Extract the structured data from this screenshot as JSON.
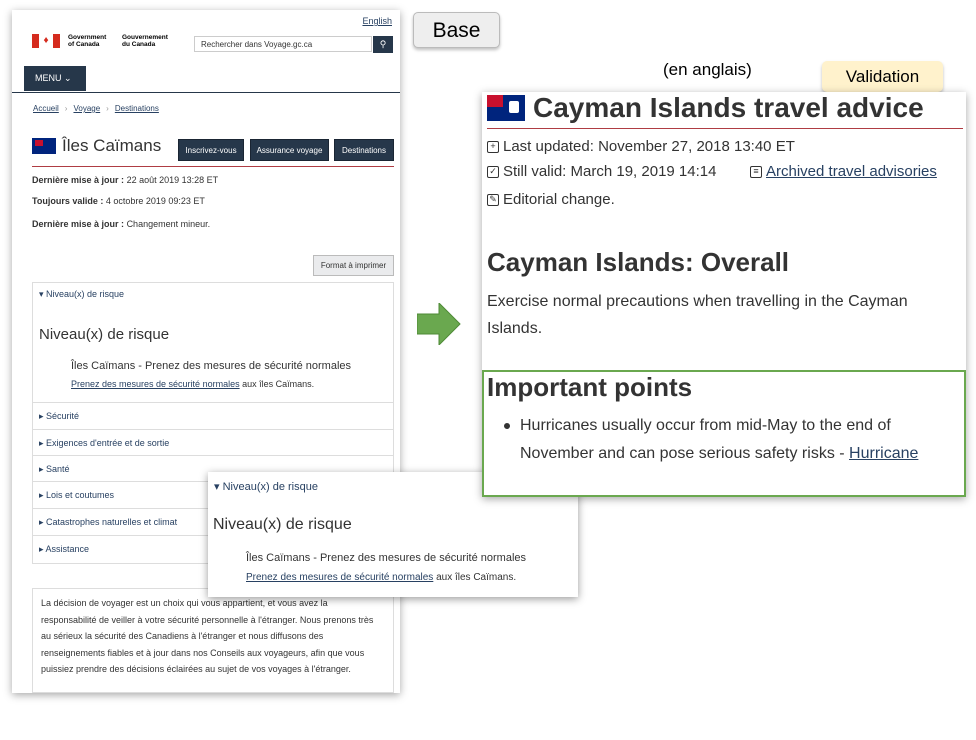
{
  "labels": {
    "base": "Base",
    "validation": "Validation",
    "en_anglais": "(en anglais)"
  },
  "base_page": {
    "lang_toggle": "English",
    "gov_en": "Government of Canada",
    "gov_fr": "Gouvernement du Canada",
    "search_placeholder": "Rechercher dans Voyage.gc.ca",
    "menu_label": "MENU",
    "breadcrumb": [
      "Accueil",
      "Voyage",
      "Destinations"
    ],
    "title": "Îles Caïmans",
    "buttons": [
      "Inscrivez-vous",
      "Assurance voyage",
      "Destinations"
    ],
    "meta": [
      {
        "label": "Dernière mise à jour :",
        "value": "22 août 2019 13:28 ET"
      },
      {
        "label": "Toujours valide :",
        "value": "4 octobre 2019 09:23 ET"
      },
      {
        "label": "Dernière mise à jour :",
        "value": "Changement mineur."
      }
    ],
    "print_button": "Format à imprimer",
    "accordion_open": "▾ Niveau(x) de risque",
    "risk_heading": "Niveau(x) de risque",
    "risk_bold": "Îles Caïmans - Prenez des mesures de sécurité normales",
    "risk_link": "Prenez des mesures de sécurité normales",
    "risk_suffix": " aux îles Caïmans.",
    "accordion_items": [
      "▸ Sécurité",
      "▸ Exigences d'entrée et de sortie",
      "▸ Santé",
      "▸ Lois et coutumes",
      "▸ Catastrophes naturelles et climat",
      "▸ Assistance"
    ],
    "disclaimer": "La décision de voyager est un choix qui vous appartient, et vous avez la responsabilité de veiller à votre sécurité personnelle à l'étranger. Nous prenons très au sérieux la sécurité des Canadiens à l'étranger et nous diffusons des renseignements fiables et à jour dans nos Conseils aux voyageurs, afin que vous puissiez prendre des décisions éclairées au sujet de vos voyages à l'étranger."
  },
  "zoom": {
    "head": "▾ Niveau(x) de risque",
    "heading": "Niveau(x) de risque",
    "bold": "Îles Caïmans - Prenez des mesures de sécurité normales",
    "link": "Prenez des mesures de sécurité normales",
    "suffix": " aux îles Caïmans."
  },
  "validation_page": {
    "title": "Cayman Islands travel advice",
    "last_updated": "Last updated: November 27, 2018 13:40 ET",
    "still_valid": "Still valid: March 19, 2019 14:14",
    "archived_link": "Archived travel advisories",
    "editorial": "Editorial change.",
    "overall_heading": "Cayman Islands: Overall",
    "overall_text": "Exercise normal precautions when travelling in the Cayman Islands.",
    "important_heading": "Important points",
    "bullet_text": "Hurricanes usually occur from mid-May to the end of November and can pose serious safety risks - ",
    "bullet_link": "Hurricane"
  },
  "colors": {
    "nav_dark": "#26374a",
    "rule_red": "#af3c43",
    "link_blue": "#284162",
    "highlight_green": "#6aa84f",
    "validation_label_bg": "#fff2cc"
  }
}
